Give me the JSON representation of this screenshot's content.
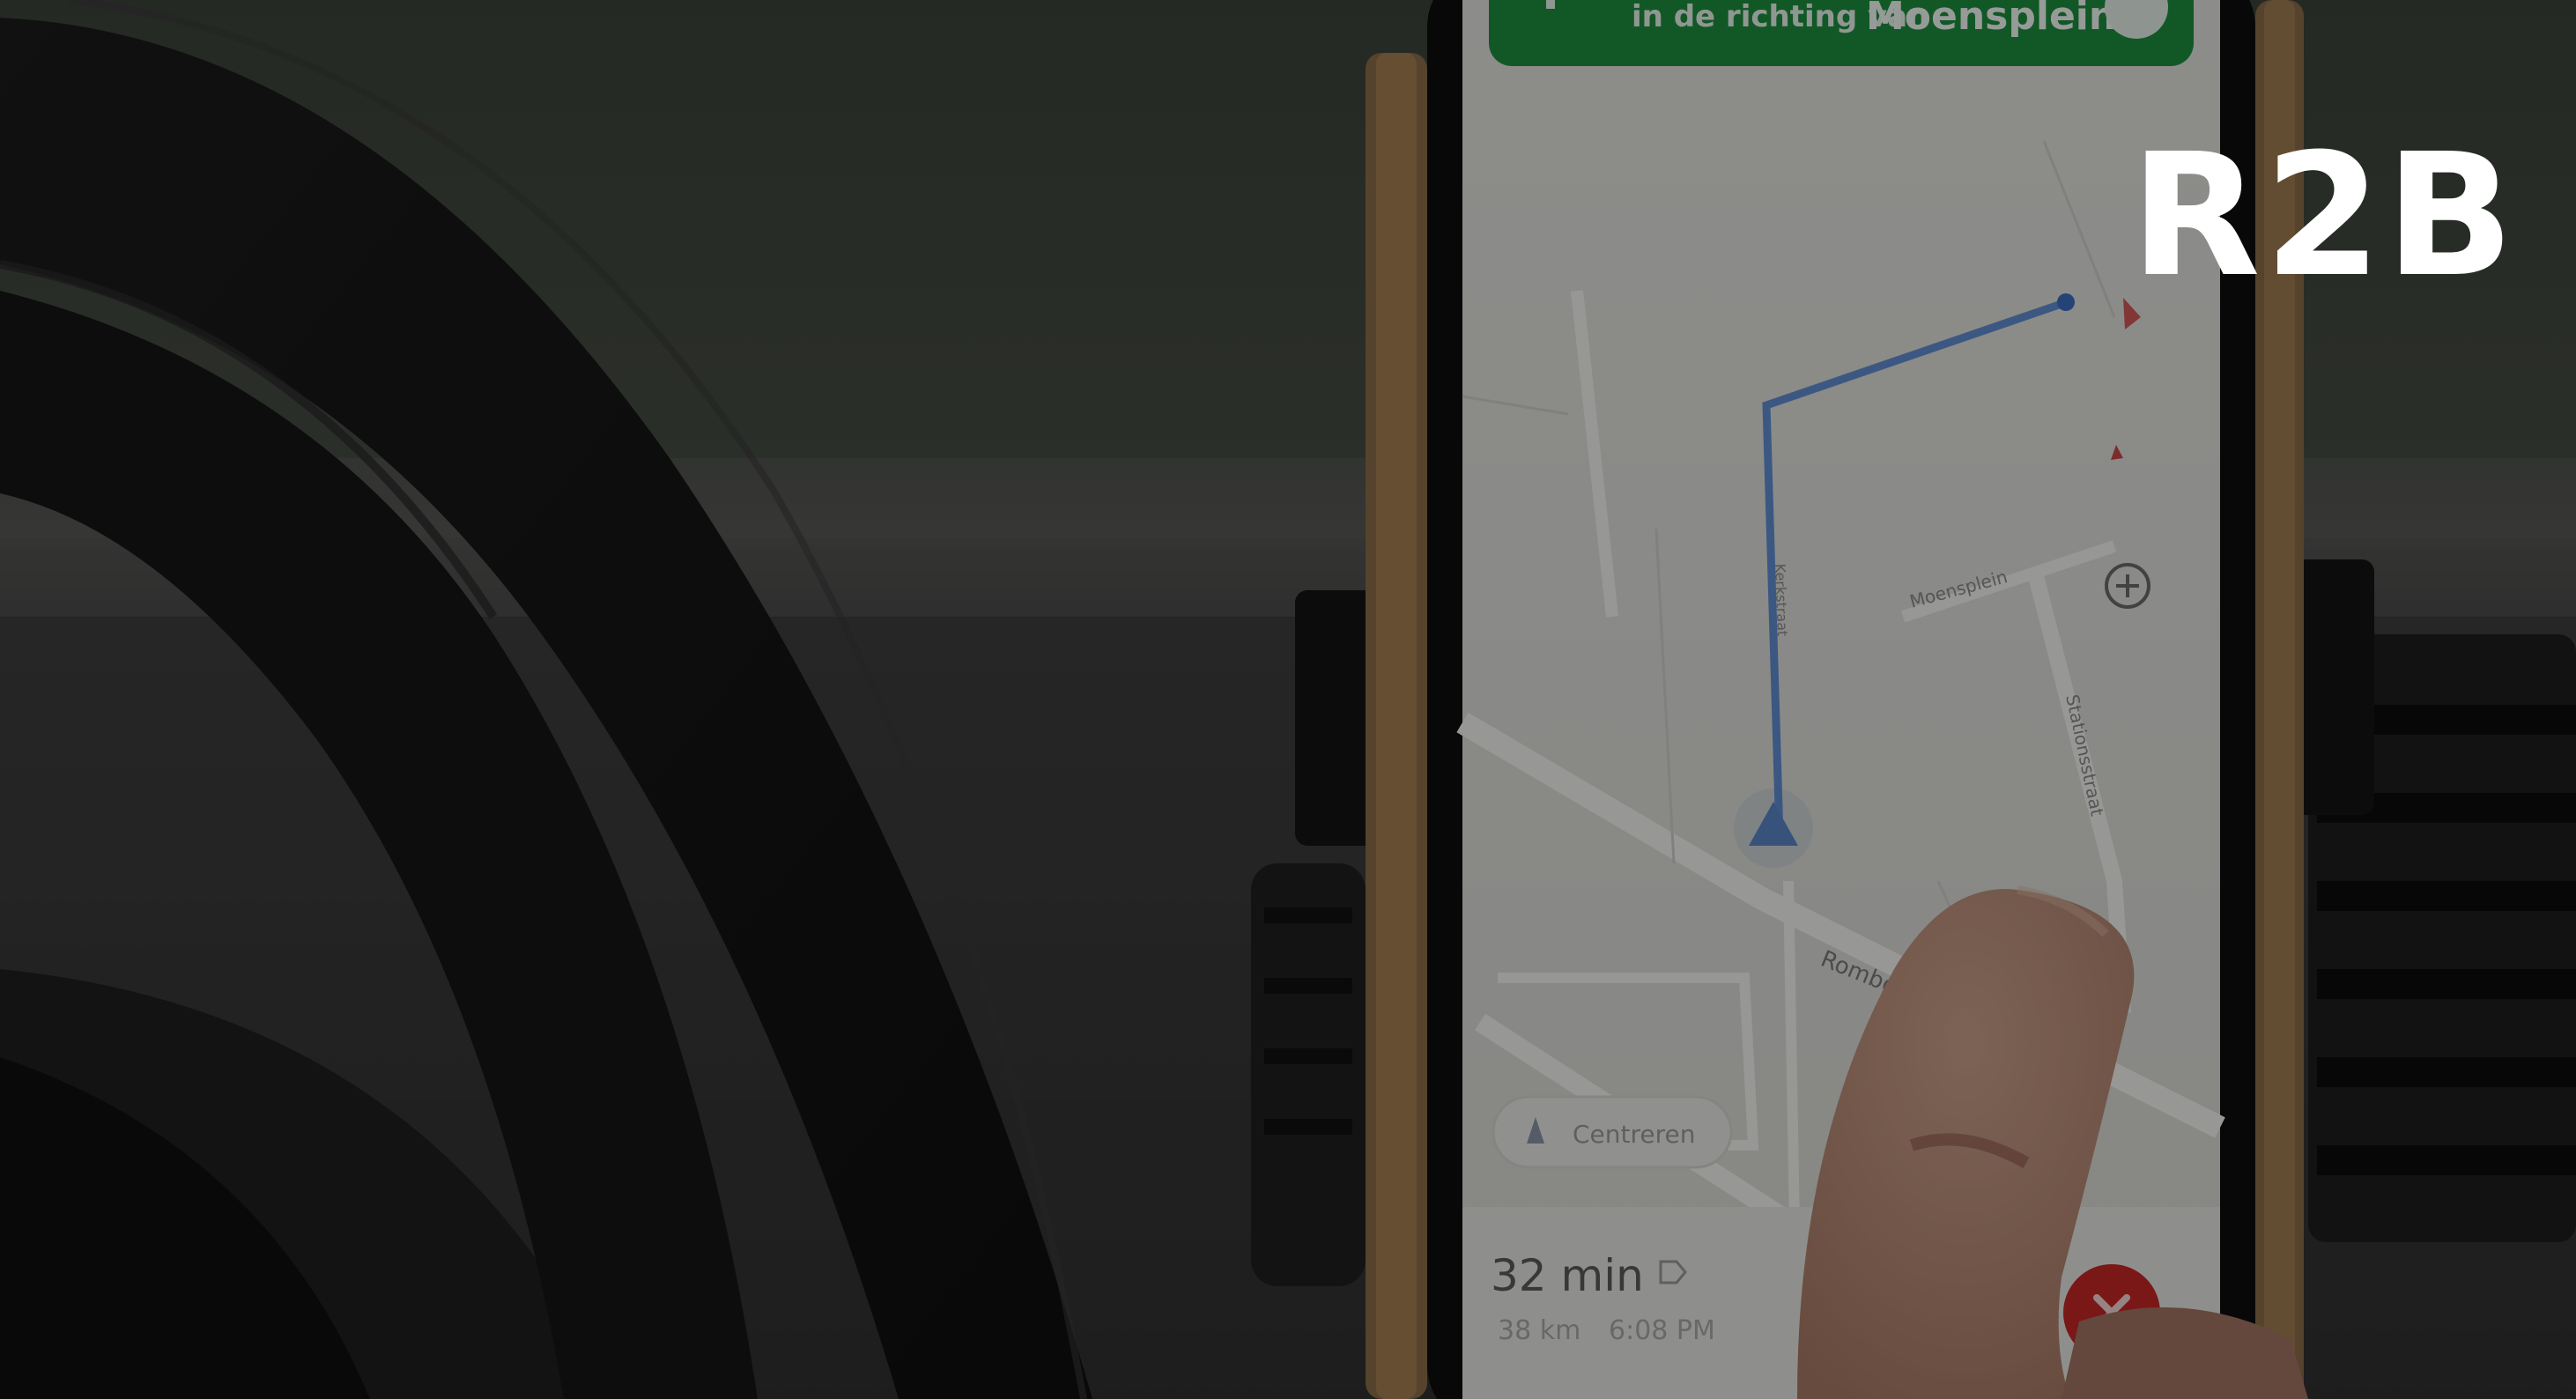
{
  "brand": {
    "logo_text": "R2B"
  },
  "navigation_app": {
    "banner": {
      "direction_prefix": "in de richting van",
      "destination": "Moensplein"
    },
    "streets": {
      "top_right": "Moensplein",
      "vertical_right": "Stationsstraat",
      "bottom_left": "Rombout",
      "vertical_left": "Kerkstraat"
    },
    "trip": {
      "duration": "32 min",
      "distance": "38 km",
      "arrival": "6:08 PM"
    },
    "re_center_label": "Centreren",
    "colors": {
      "banner": "#1e8e3e",
      "route": "#4a7fd0",
      "close_button": "#c62828"
    }
  }
}
